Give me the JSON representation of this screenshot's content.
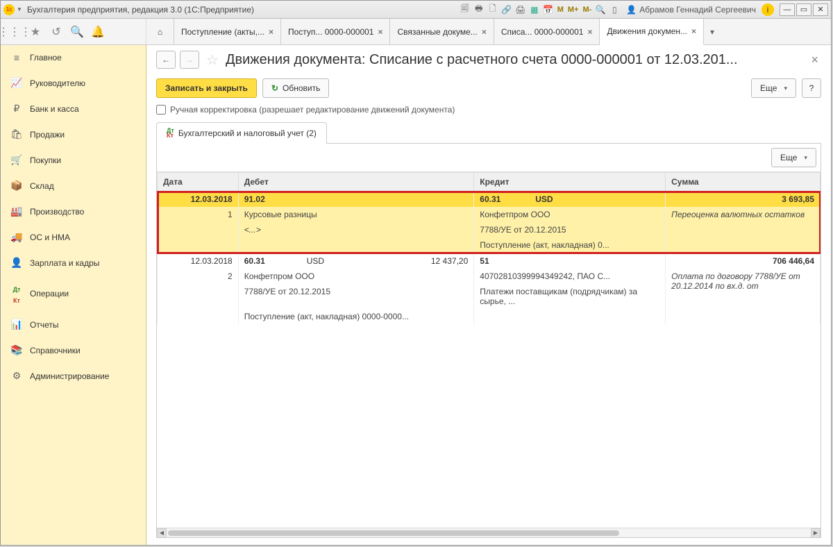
{
  "titlebar": {
    "title": "Бухгалтерия предприятия, редакция 3.0  (1С:Предприятие)",
    "m1": "M",
    "m2": "M+",
    "m3": "M-",
    "user": "Абрамов Геннадий Сергеевич"
  },
  "tabs": [
    {
      "label": "Поступление (акты,..."
    },
    {
      "label": "Поступ... 0000-000001"
    },
    {
      "label": "Связанные докуме..."
    },
    {
      "label": "Списа... 0000-000001"
    },
    {
      "label": "Движения докумен..."
    }
  ],
  "sidebar": [
    {
      "icon": "≡",
      "label": "Главное"
    },
    {
      "icon": "📈",
      "label": "Руководителю"
    },
    {
      "icon": "₽",
      "label": "Банк и касса"
    },
    {
      "icon": "🛍",
      "label": "Продажи"
    },
    {
      "icon": "🛒",
      "label": "Покупки"
    },
    {
      "icon": "📦",
      "label": "Склад"
    },
    {
      "icon": "🏭",
      "label": "Производство"
    },
    {
      "icon": "🚚",
      "label": "ОС и НМА"
    },
    {
      "icon": "👤",
      "label": "Зарплата и кадры"
    },
    {
      "icon": "дт",
      "label": "Операции"
    },
    {
      "icon": "📊",
      "label": "Отчеты"
    },
    {
      "icon": "📚",
      "label": "Справочники"
    },
    {
      "icon": "⚙",
      "label": "Администрирование"
    }
  ],
  "page": {
    "title": "Движения документа: Списание с расчетного счета 0000-000001 от 12.03.201...",
    "save_close": "Записать и закрыть",
    "refresh": "Обновить",
    "more": "Еще",
    "help": "?",
    "manual_label": "Ручная корректировка (разрешает редактирование движений документа)",
    "subtab": "Бухгалтерский и налоговый учет (2)"
  },
  "table": {
    "more": "Еще",
    "headers": {
      "date": "Дата",
      "debit": "Дебет",
      "credit": "Кредит",
      "sum": "Сумма"
    },
    "row1": {
      "date": "12.03.2018",
      "num": "1",
      "deb_acc": "91.02",
      "deb_l1": "Курсовые разницы",
      "deb_l2": "<...>",
      "cr_acc": "60.31",
      "cr_cur": "USD",
      "cr_l1": "Конфетпром ООО",
      "cr_l2": "7788/УЕ от 20.12.2015",
      "cr_l3": "Поступление (акт, накладная) 0...",
      "sum": "3 693,85",
      "sum_desc": "Переоценка валютных остатков"
    },
    "row2": {
      "date": "12.03.2018",
      "num": "2",
      "deb_acc": "60.31",
      "deb_cur": "USD",
      "deb_amt": "12 437,20",
      "deb_l1": "Конфетпром ООО",
      "deb_l2": "7788/УЕ от 20.12.2015",
      "deb_l3": "Поступление (акт, накладная) 0000-0000...",
      "cr_acc": "51",
      "cr_l1": "40702810399994349242, ПАО С...",
      "cr_l2": "Платежи поставщикам (подрядчикам) за сырье, ...",
      "sum": "706 446,64",
      "sum_desc": "Оплата по договору 7788/УЕ от 20.12.2014 по вх.д. от"
    }
  }
}
